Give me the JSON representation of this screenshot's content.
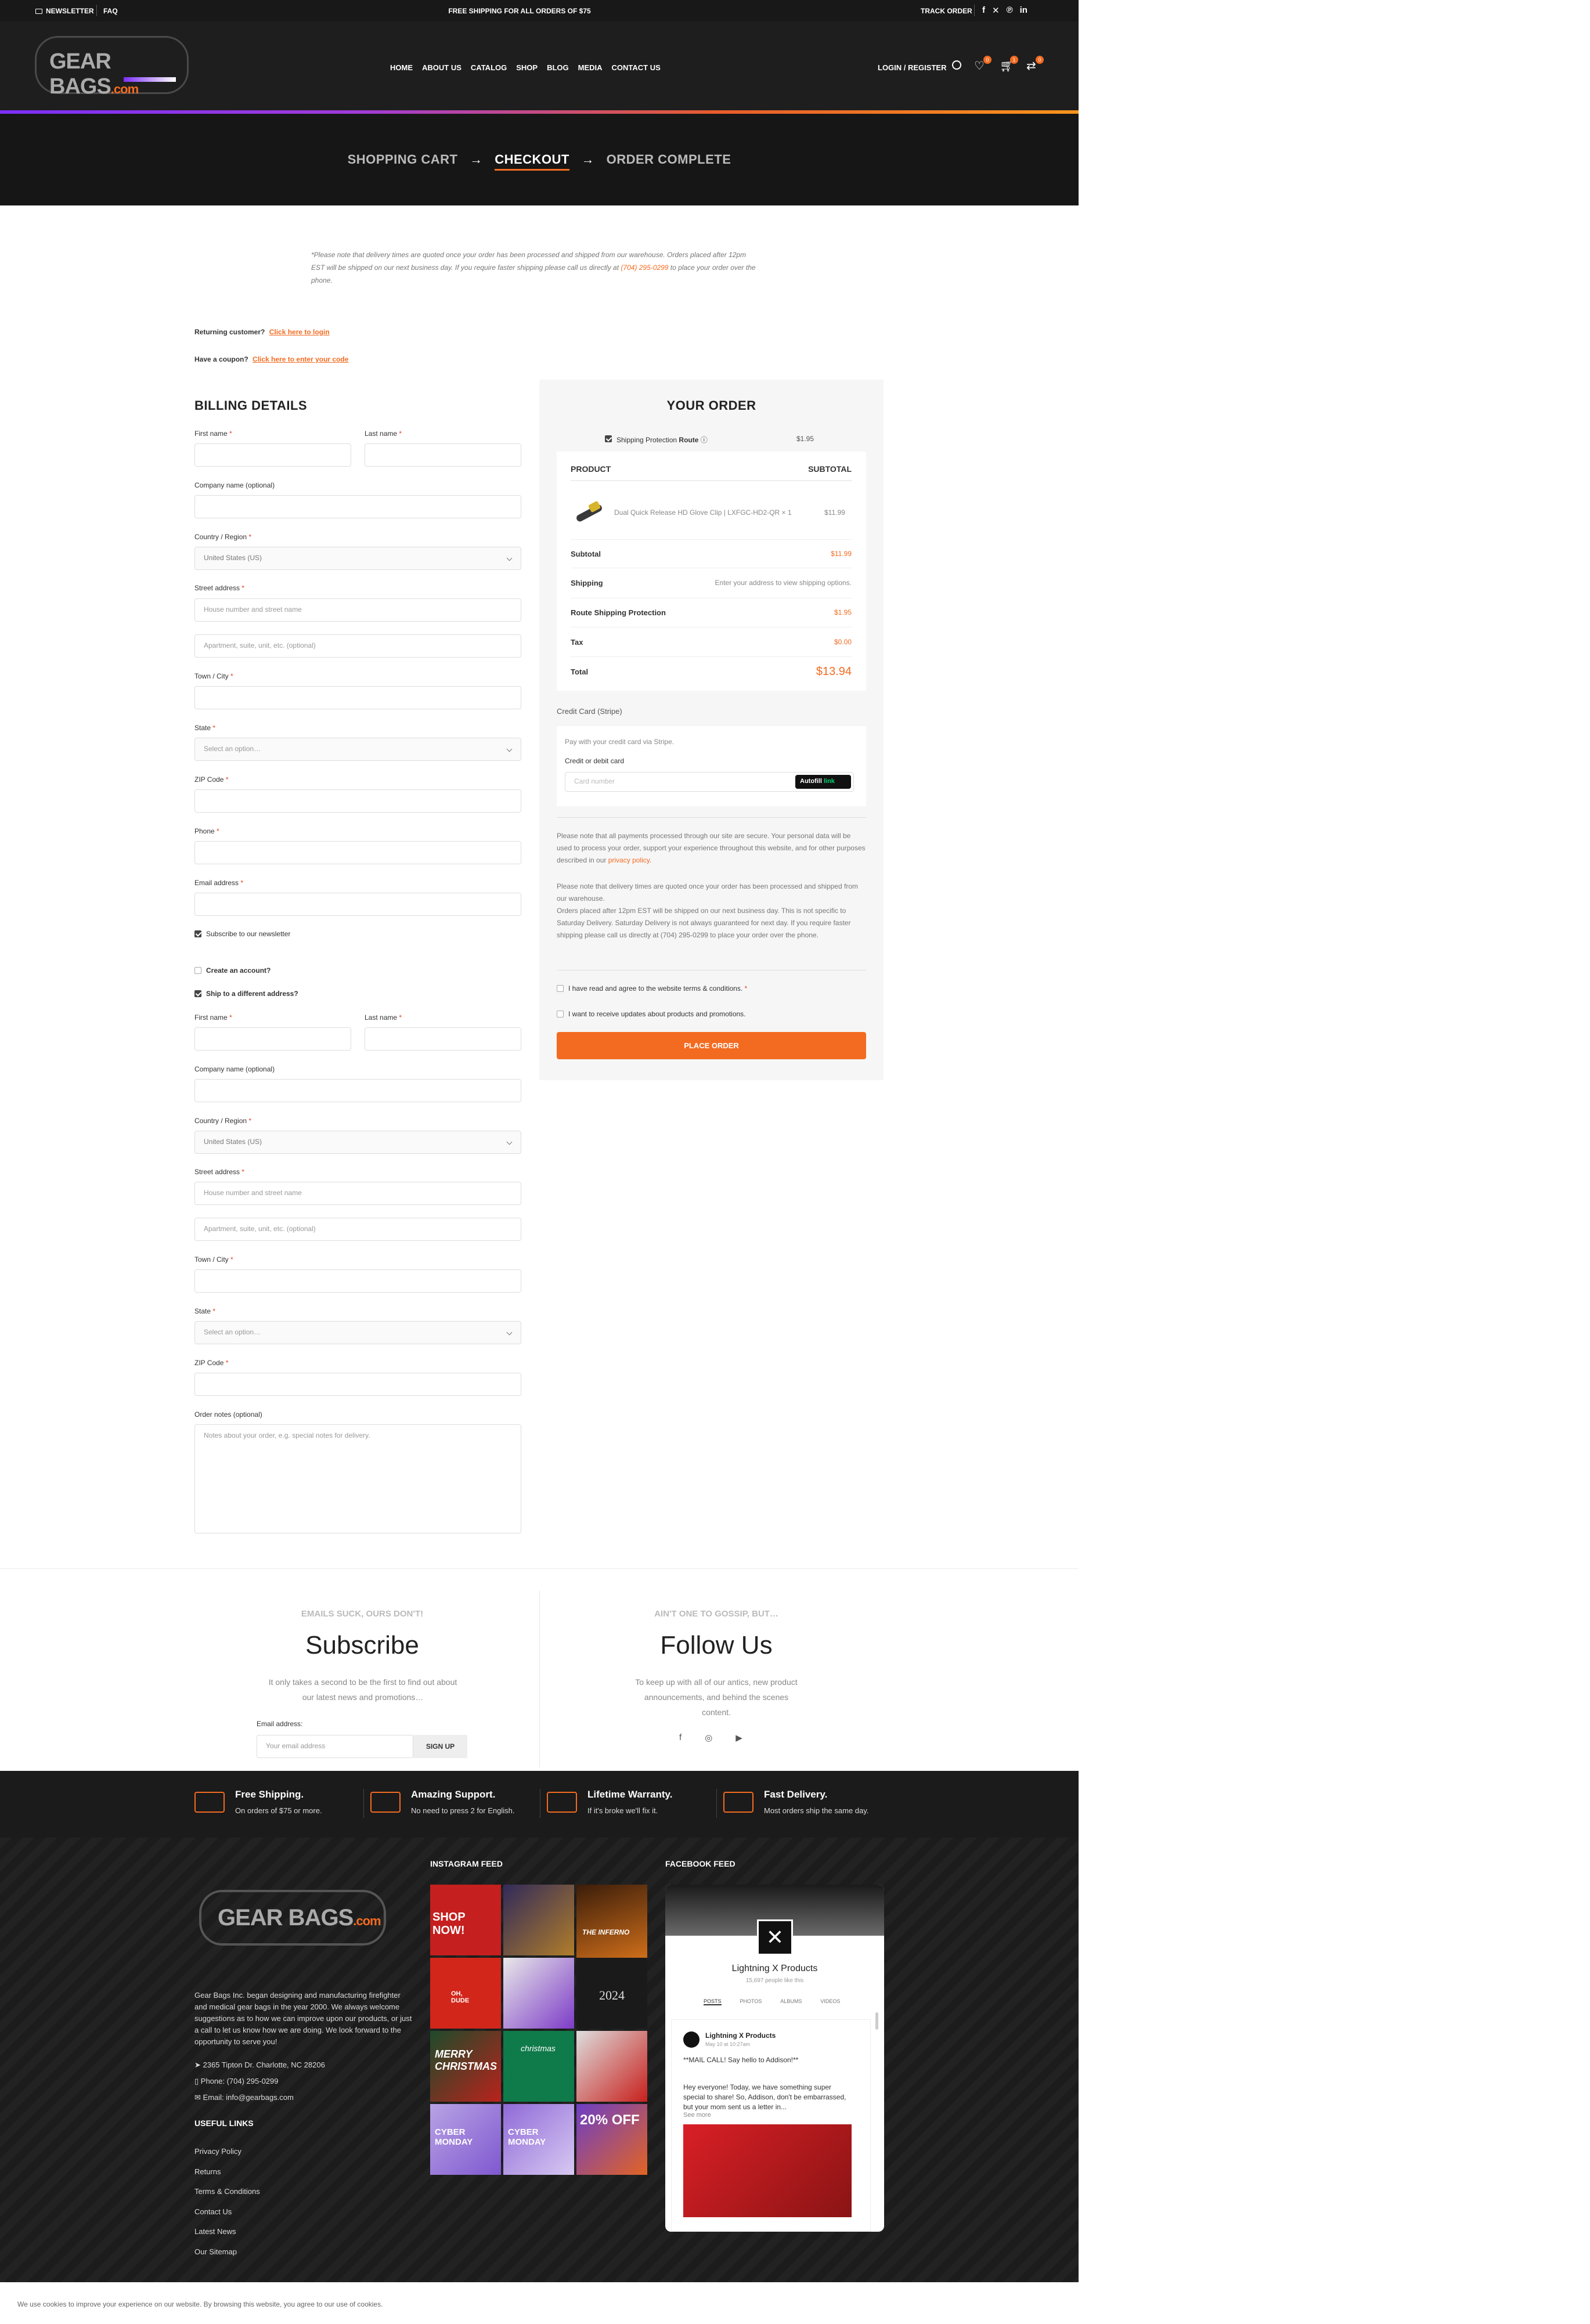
{
  "topbar": {
    "newsletter": "NEWSLETTER",
    "faq": "FAQ",
    "promo": "FREE SHIPPING FOR ALL ORDERS OF $75",
    "track": "TRACK ORDER"
  },
  "header": {
    "logo_text": "GEAR BAGS",
    "logo_suffix": ".com",
    "nav": [
      "HOME",
      "ABOUT US",
      "CATALOG",
      "SHOP",
      "BLOG",
      "MEDIA",
      "CONTACT US"
    ],
    "login": "LOGIN / REGISTER",
    "badges": {
      "wishlist": "0",
      "cart": "1",
      "compare": "0"
    }
  },
  "breadcrumb": {
    "step1": "SHOPPING CART",
    "step2": "CHECKOUT",
    "step3": "ORDER COMPLETE",
    "arrow": "→"
  },
  "notice": {
    "text_before": "*Please note that delivery times are quoted once your order has been processed and shipped from our warehouse. Orders placed after 12pm EST will be shipped on our next business day. If you require faster shipping please call us directly at ",
    "phone": "(704) 295-0299",
    "text_after": " to place your order over the phone."
  },
  "returning": {
    "label": "Returning customer?",
    "link": "Click here to login"
  },
  "coupon": {
    "label": "Have a coupon?",
    "link": "Click here to enter your code"
  },
  "billing": {
    "title": "BILLING DETAILS",
    "first_name": "First name",
    "last_name": "Last name",
    "company": "Company name (optional)",
    "country": "Country / Region",
    "country_value": "United States (US)",
    "street": "Street address",
    "street_placeholder": "House number and street name",
    "apt_placeholder": "Apartment, suite, unit, etc. (optional)",
    "town": "Town / City",
    "state": "State",
    "state_placeholder": "Select an option…",
    "zip": "ZIP Code",
    "phone": "Phone",
    "email": "Email address",
    "subscribe": "Subscribe to our newsletter",
    "create_account": "Create an account?",
    "ship_different": "Ship to a different address?",
    "order_notes": "Order notes (optional)",
    "notes_placeholder": "Notes about your order, e.g. special notes for delivery.",
    "required_mark": "*"
  },
  "order": {
    "title": "YOUR ORDER",
    "shipping_protection": "Shipping Protection",
    "route": "Route",
    "protection_price": "$1.95",
    "col_product": "PRODUCT",
    "col_subtotal": "SUBTOTAL",
    "item_name": "Dual Quick Release HD Glove Clip | LXFGC-HD2-QR",
    "item_qty": "× 1",
    "item_price": "$11.99",
    "subtotal_label": "Subtotal",
    "subtotal_value": "$11.99",
    "shipping_label": "Shipping",
    "shipping_value": "Enter your address to view shipping options.",
    "route_label": "Route Shipping Protection",
    "route_value": "$1.95",
    "tax_label": "Tax",
    "tax_value": "$0.00",
    "total_label": "Total",
    "total_value": "$13.94",
    "payment_method": "Credit Card (Stripe)",
    "stripe_note": "Pay with your credit card via Stripe.",
    "card_label": "Credit or debit card",
    "card_placeholder": "Card number",
    "autofill": "Autofill",
    "link": "link",
    "privacy_text": "Please note that all payments processed through our site are secure. Your personal data will be used to process your order, support your experience throughout this website, and for other purposes described in our ",
    "privacy_link": "privacy policy",
    "delivery_note1": "Please note that delivery times are quoted once your order has been processed and shipped from our warehouse.",
    "delivery_note2": "Orders placed after 12pm EST will be shipped on our next business day. This is not specific to Saturday Delivery. Saturday Delivery is not always guaranteed for next day. If you require faster shipping please call us directly at (704) 295-0299 to place your order over the phone.",
    "terms": "I have read and agree to the website terms & conditions.",
    "updates": "I want to receive updates about products and promotions.",
    "place_order": "PLACE ORDER"
  },
  "subscribe": {
    "kicker": "EMAILS SUCK, OURS DON'T!",
    "title": "Subscribe",
    "text": "It only takes a second to be the first to find out about our latest news and promotions…",
    "email_label": "Email address:",
    "email_placeholder": "Your email address",
    "button": "SIGN UP"
  },
  "follow": {
    "kicker": "AIN'T ONE TO GOSSIP, BUT…",
    "title": "Follow Us",
    "text": "To keep up with all of our antics, new product announcements, and behind the scenes content."
  },
  "features": [
    {
      "title": "Free Shipping.",
      "text": "On orders of $75 or more."
    },
    {
      "title": "Amazing Support.",
      "text": "No need to press 2 for English."
    },
    {
      "title": "Lifetime Warranty.",
      "text": "If it's broke we'll fix it."
    },
    {
      "title": "Fast Delivery.",
      "text": "Most orders ship the same day."
    }
  ],
  "footer": {
    "about": "Gear Bags Inc. began designing and manufacturing firefighter and medical gear bags in the year 2000. We always welcome suggestions as to how we can improve upon our products, or just a call to let us know how we are doing. We look forward to the opportunity to serve you!",
    "address": "2365 Tipton Dr. Charlotte, NC 28206",
    "phone": "Phone: (704) 295-0299",
    "email": "Email: info@gearbags.com",
    "links_title": "USEFUL LINKS",
    "links": [
      "Privacy Policy",
      "Returns",
      "Terms & Conditions",
      "Contact Us",
      "Latest News",
      "Our Sitemap"
    ],
    "instagram_title": "INSTAGRAM FEED",
    "instagram_tiles": [
      "SHOP NOW!",
      "",
      "THE INFERNO",
      "OH, DUDE",
      "",
      "2024",
      "MERRY CHRISTMAS",
      "christmas",
      "",
      "CYBER MONDAY",
      "CYBER MONDAY",
      "20% OFF"
    ],
    "facebook_title": "FACEBOOK FEED",
    "fb_page": "Lightning X Products",
    "fb_likes": "15,697 people like this",
    "fb_tabs": [
      "POSTS",
      "PHOTOS",
      "ALBUMS",
      "VIDEOS"
    ],
    "fb_post_author": "Lightning X Products",
    "fb_post_date": "May 10 at 10:27am",
    "fb_post_line1": "**MAIL CALL! Say hello to Addison!**",
    "fb_post_body": "Hey everyone! Today, we have something super special to share! So, Addison, don't be embarrassed, but your mom sent us a letter in...",
    "fb_see_more": "See more"
  },
  "cookie": {
    "text": "We use cookies to improve your experience on our website. By browsing this website, you agree to our use of cookies."
  },
  "colors": {
    "accent": "#f36b21",
    "dark": "#1e1e1e",
    "purple": "#7b2ff7"
  }
}
